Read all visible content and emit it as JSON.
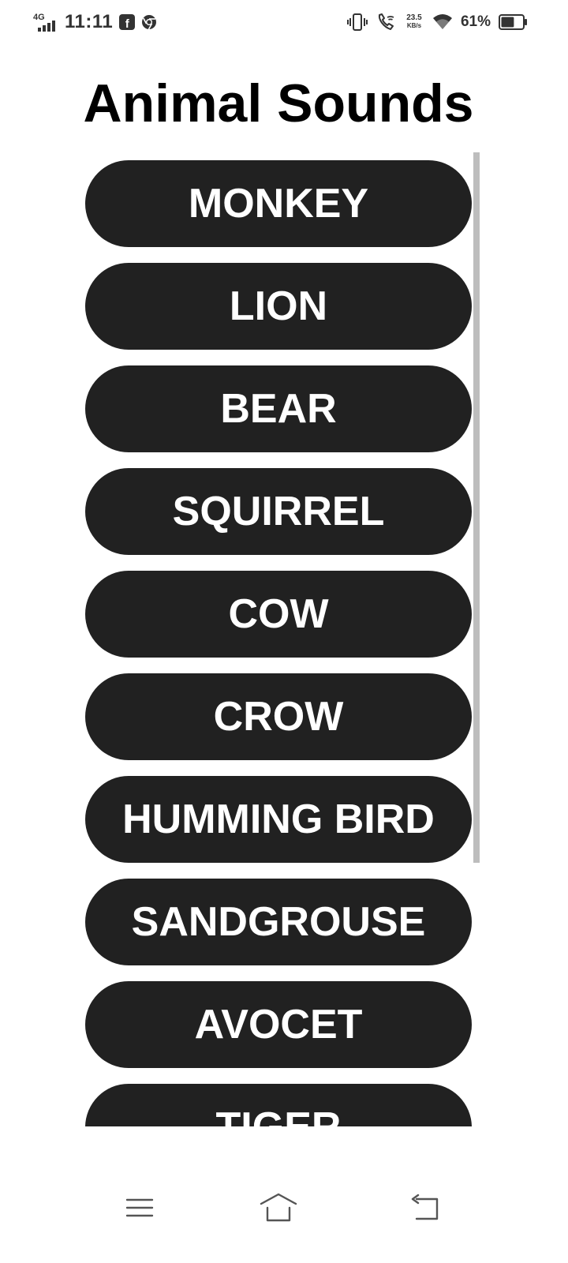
{
  "status_bar": {
    "network": "4G",
    "time": "11:11",
    "speed_value": "23.5",
    "speed_unit": "KB/s",
    "battery_percent": "61%",
    "battery_level": 0.61,
    "icons": [
      "signal-icon",
      "facebook-icon",
      "chrome-icon",
      "vibrate-icon",
      "wifi-calling-icon",
      "wifi-icon",
      "battery-icon"
    ]
  },
  "app": {
    "title": "Animal Sounds",
    "button_color": "#212121",
    "button_text_color": "#ffffff",
    "animals": [
      {
        "label": "MONKEY"
      },
      {
        "label": "LION"
      },
      {
        "label": "BEAR"
      },
      {
        "label": "SQUIRREL"
      },
      {
        "label": "COW"
      },
      {
        "label": "CROW"
      },
      {
        "label": "HUMMING BIRD"
      },
      {
        "label": "SANDGROUSE"
      },
      {
        "label": "AVOCET"
      },
      {
        "label": "TIGER"
      }
    ]
  },
  "nav_bar": {
    "icons": [
      "menu-icon",
      "home-icon",
      "back-icon"
    ]
  }
}
